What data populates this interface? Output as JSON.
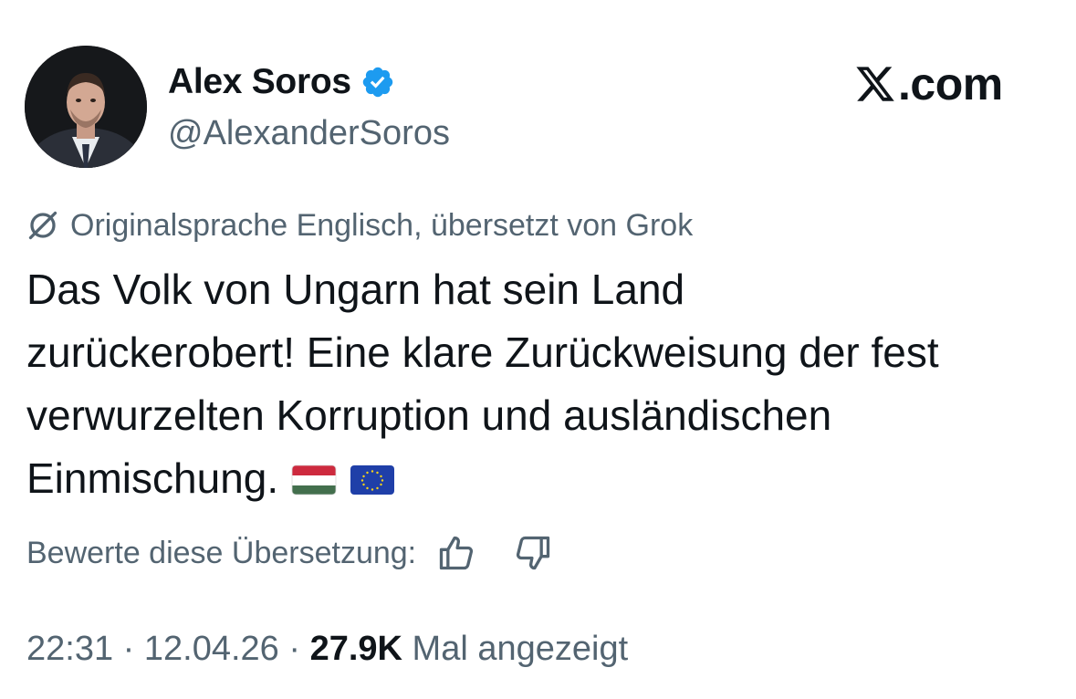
{
  "author": {
    "display_name": "Alex Soros",
    "handle": "@AlexanderSoros",
    "verified": true
  },
  "brand": {
    "text": ".com",
    "icon": "x-logo-icon"
  },
  "translation": {
    "note": "Originalsprache Englisch, übersetzt von Grok",
    "icon": "grok-icon"
  },
  "tweet": {
    "lines": [
      "Das Volk von Ungarn hat sein Land",
      "zurückerobert! Eine klare Zurückweisung der fest",
      "verwurzelten Korruption und ausländischen",
      "Einmischung."
    ],
    "emojis": [
      "hungary-flag",
      "eu-flag"
    ]
  },
  "rating": {
    "label": "Bewerte diese Übersetzung:",
    "up_icon": "thumbs-up-icon",
    "down_icon": "thumbs-down-icon"
  },
  "meta": {
    "time": "22:31",
    "separator": " · ",
    "date": "12.04.26",
    "views_count": "27.9K",
    "views_label": "Mal angezeigt"
  },
  "colors": {
    "text_primary": "#0f1419",
    "text_secondary": "#536471",
    "verified_blue": "#1d9bf0",
    "background": "#ffffff"
  }
}
